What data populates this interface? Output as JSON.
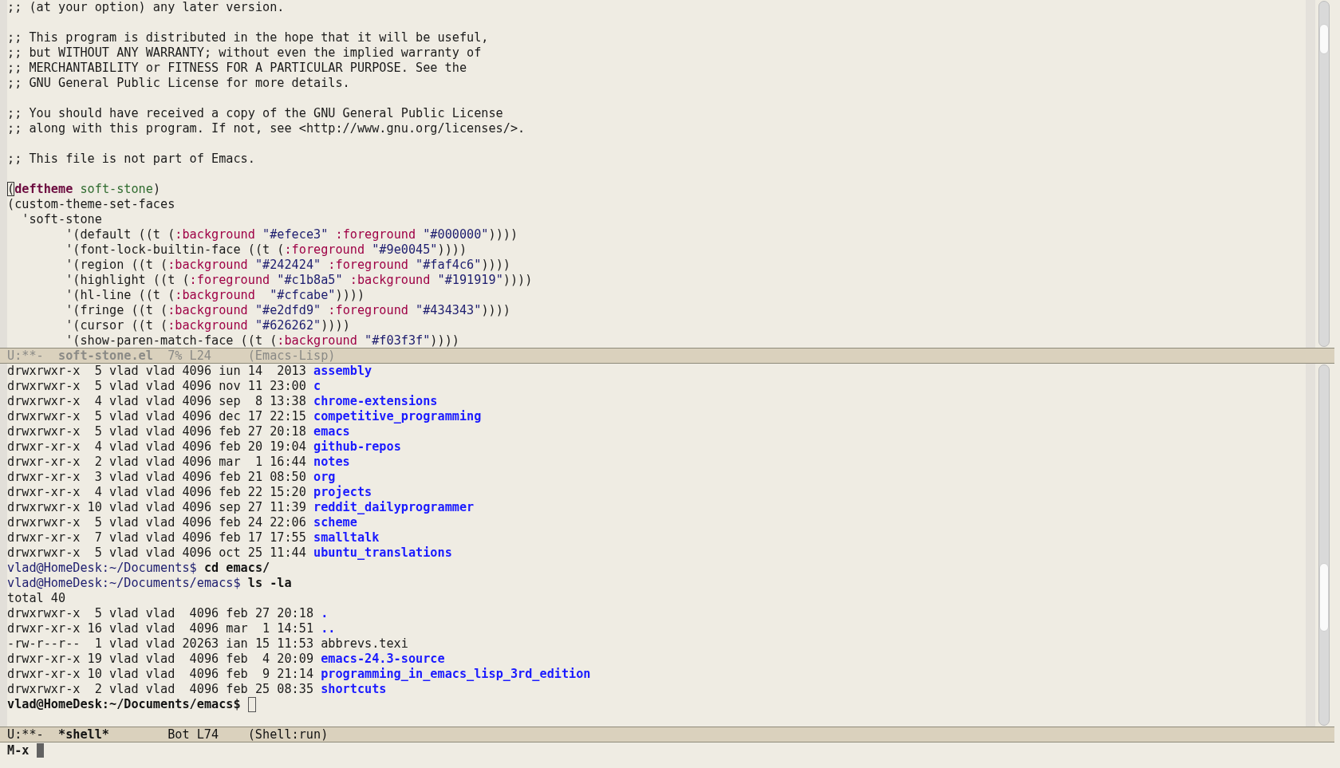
{
  "editor": {
    "lines": [
      {
        "kind": "text",
        "segments": [
          {
            "text": ";; (at your option) any later version.",
            "kind": "plain"
          }
        ]
      },
      {
        "kind": "blank"
      },
      {
        "kind": "text",
        "segments": [
          {
            "text": ";; This program is distributed in the hope that it will be useful,",
            "kind": "plain"
          }
        ]
      },
      {
        "kind": "text",
        "segments": [
          {
            "text": ";; but WITHOUT ANY WARRANTY; without even the implied warranty of",
            "kind": "plain"
          }
        ]
      },
      {
        "kind": "text",
        "segments": [
          {
            "text": ";; MERCHANTABILITY or FITNESS FOR A PARTICULAR PURPOSE. See the",
            "kind": "plain"
          }
        ]
      },
      {
        "kind": "text",
        "segments": [
          {
            "text": ";; GNU General Public License for more details.",
            "kind": "plain"
          }
        ]
      },
      {
        "kind": "blank"
      },
      {
        "kind": "text",
        "segments": [
          {
            "text": ";; You should have received a copy of the GNU General Public License",
            "kind": "plain"
          }
        ]
      },
      {
        "kind": "text",
        "segments": [
          {
            "text": ";; along with this program. If not, see <http://www.gnu.org/licenses/>.",
            "kind": "plain"
          }
        ]
      },
      {
        "kind": "blank"
      },
      {
        "kind": "text",
        "segments": [
          {
            "text": ";; This file is not part of Emacs.",
            "kind": "plain"
          }
        ]
      },
      {
        "kind": "blank"
      },
      {
        "kind": "text",
        "segments": [
          {
            "text": "(",
            "kind": "cursor"
          },
          {
            "text": "deftheme ",
            "kind": "keyword"
          },
          {
            "text": "soft-stone",
            "kind": "name"
          },
          {
            "text": ")",
            "kind": "plain"
          }
        ]
      },
      {
        "kind": "text",
        "segments": [
          {
            "text": "(custom-theme-set-faces",
            "kind": "plain"
          }
        ]
      },
      {
        "kind": "text",
        "segments": [
          {
            "text": "  'soft-stone",
            "kind": "plain"
          }
        ]
      },
      {
        "kind": "text",
        "segments": [
          {
            "text": "        '(default ((t (",
            "kind": "plain"
          },
          {
            "text": ":background ",
            "kind": "builtin"
          },
          {
            "text": "\"#efece3\" ",
            "kind": "string"
          },
          {
            "text": ":foreground ",
            "kind": "builtin"
          },
          {
            "text": "\"#000000\"",
            "kind": "string"
          },
          {
            "text": "))))",
            "kind": "plain"
          }
        ]
      },
      {
        "kind": "text",
        "segments": [
          {
            "text": "        '(font-lock-builtin-face ((t (",
            "kind": "plain"
          },
          {
            "text": ":foreground ",
            "kind": "builtin"
          },
          {
            "text": "\"#9e0045\"",
            "kind": "string"
          },
          {
            "text": "))))",
            "kind": "plain"
          }
        ]
      },
      {
        "kind": "text",
        "segments": [
          {
            "text": "        '(region ((t (",
            "kind": "plain"
          },
          {
            "text": ":background ",
            "kind": "builtin"
          },
          {
            "text": "\"#242424\" ",
            "kind": "string"
          },
          {
            "text": ":foreground ",
            "kind": "builtin"
          },
          {
            "text": "\"#faf4c6\"",
            "kind": "string"
          },
          {
            "text": "))))",
            "kind": "plain"
          }
        ]
      },
      {
        "kind": "text",
        "segments": [
          {
            "text": "        '(highlight ((t (",
            "kind": "plain"
          },
          {
            "text": ":foreground ",
            "kind": "builtin"
          },
          {
            "text": "\"#c1b8a5\" ",
            "kind": "string"
          },
          {
            "text": ":background ",
            "kind": "builtin"
          },
          {
            "text": "\"#191919\"",
            "kind": "string"
          },
          {
            "text": "))))",
            "kind": "plain"
          }
        ]
      },
      {
        "kind": "text",
        "segments": [
          {
            "text": "        '(hl-line ((t (",
            "kind": "plain"
          },
          {
            "text": ":background  ",
            "kind": "builtin"
          },
          {
            "text": "\"#cfcabe\"",
            "kind": "string"
          },
          {
            "text": "))))",
            "kind": "plain"
          }
        ]
      },
      {
        "kind": "text",
        "segments": [
          {
            "text": "        '(fringe ((t (",
            "kind": "plain"
          },
          {
            "text": ":background ",
            "kind": "builtin"
          },
          {
            "text": "\"#e2dfd9\" ",
            "kind": "string"
          },
          {
            "text": ":foreground ",
            "kind": "builtin"
          },
          {
            "text": "\"#434343\"",
            "kind": "string"
          },
          {
            "text": "))))",
            "kind": "plain"
          }
        ]
      },
      {
        "kind": "text",
        "segments": [
          {
            "text": "        '(cursor ((t (",
            "kind": "plain"
          },
          {
            "text": ":background ",
            "kind": "builtin"
          },
          {
            "text": "\"#626262\"",
            "kind": "string"
          },
          {
            "text": "))))",
            "kind": "plain"
          }
        ]
      },
      {
        "kind": "text",
        "segments": [
          {
            "text": "        '(show-paren-match-face ((t (",
            "kind": "plain"
          },
          {
            "text": ":background ",
            "kind": "builtin"
          },
          {
            "text": "\"#f03f3f\"",
            "kind": "string"
          },
          {
            "text": "))))",
            "kind": "plain"
          }
        ]
      }
    ],
    "mode_line": {
      "active": false,
      "status": "U:**-",
      "buffer": "soft-stone.el",
      "position": "7% L24",
      "mode": "(Emacs-Lisp)"
    }
  },
  "shell": {
    "lines": [
      {
        "kind": "text",
        "segments": [
          {
            "text": "drwxrwxr-x  5 vlad vlad 4096 iun 14  2013 ",
            "kind": "plain"
          },
          {
            "text": "assembly",
            "kind": "dir"
          }
        ]
      },
      {
        "kind": "text",
        "segments": [
          {
            "text": "drwxrwxr-x  5 vlad vlad 4096 nov 11 23:00 ",
            "kind": "plain"
          },
          {
            "text": "c",
            "kind": "dir"
          }
        ]
      },
      {
        "kind": "text",
        "segments": [
          {
            "text": "drwxrwxr-x  4 vlad vlad 4096 sep  8 13:38 ",
            "kind": "plain"
          },
          {
            "text": "chrome-extensions",
            "kind": "dir"
          }
        ]
      },
      {
        "kind": "text",
        "segments": [
          {
            "text": "drwxrwxr-x  5 vlad vlad 4096 dec 17 22:15 ",
            "kind": "plain"
          },
          {
            "text": "competitive_programming",
            "kind": "dir"
          }
        ]
      },
      {
        "kind": "text",
        "segments": [
          {
            "text": "drwxrwxr-x  5 vlad vlad 4096 feb 27 20:18 ",
            "kind": "plain"
          },
          {
            "text": "emacs",
            "kind": "dir"
          }
        ]
      },
      {
        "kind": "text",
        "segments": [
          {
            "text": "drwxr-xr-x  4 vlad vlad 4096 feb 20 19:04 ",
            "kind": "plain"
          },
          {
            "text": "github-repos",
            "kind": "dir"
          }
        ]
      },
      {
        "kind": "text",
        "segments": [
          {
            "text": "drwxr-xr-x  2 vlad vlad 4096 mar  1 16:44 ",
            "kind": "plain"
          },
          {
            "text": "notes",
            "kind": "dir"
          }
        ]
      },
      {
        "kind": "text",
        "segments": [
          {
            "text": "drwxr-xr-x  3 vlad vlad 4096 feb 21 08:50 ",
            "kind": "plain"
          },
          {
            "text": "org",
            "kind": "dir"
          }
        ]
      },
      {
        "kind": "text",
        "segments": [
          {
            "text": "drwxr-xr-x  4 vlad vlad 4096 feb 22 15:20 ",
            "kind": "plain"
          },
          {
            "text": "projects",
            "kind": "dir"
          }
        ]
      },
      {
        "kind": "text",
        "segments": [
          {
            "text": "drwxrwxr-x 10 vlad vlad 4096 sep 27 11:39 ",
            "kind": "plain"
          },
          {
            "text": "reddit_dailyprogrammer",
            "kind": "dir"
          }
        ]
      },
      {
        "kind": "text",
        "segments": [
          {
            "text": "drwxrwxr-x  5 vlad vlad 4096 feb 24 22:06 ",
            "kind": "plain"
          },
          {
            "text": "scheme",
            "kind": "dir"
          }
        ]
      },
      {
        "kind": "text",
        "segments": [
          {
            "text": "drwxr-xr-x  7 vlad vlad 4096 feb 17 17:55 ",
            "kind": "plain"
          },
          {
            "text": "smalltalk",
            "kind": "dir"
          }
        ]
      },
      {
        "kind": "text",
        "segments": [
          {
            "text": "drwxrwxr-x  5 vlad vlad 4096 oct 25 11:44 ",
            "kind": "plain"
          },
          {
            "text": "ubuntu_translations",
            "kind": "dir"
          }
        ]
      },
      {
        "kind": "text",
        "segments": [
          {
            "text": "vlad@HomeDesk:~/Documents$",
            "kind": "prompt"
          },
          {
            "text": " cd emacs/",
            "kind": "command"
          }
        ]
      },
      {
        "kind": "text",
        "segments": [
          {
            "text": "vlad@HomeDesk:~/Documents/emacs$",
            "kind": "prompt"
          },
          {
            "text": " ls -la",
            "kind": "command"
          }
        ]
      },
      {
        "kind": "text",
        "segments": [
          {
            "text": "total 40",
            "kind": "plain"
          }
        ]
      },
      {
        "kind": "text",
        "segments": [
          {
            "text": "drwxrwxr-x  5 vlad vlad  4096 feb 27 20:18 ",
            "kind": "plain"
          },
          {
            "text": ".",
            "kind": "dir"
          }
        ]
      },
      {
        "kind": "text",
        "segments": [
          {
            "text": "drwxr-xr-x 16 vlad vlad  4096 mar  1 14:51 ",
            "kind": "plain"
          },
          {
            "text": "..",
            "kind": "dir"
          }
        ]
      },
      {
        "kind": "text",
        "segments": [
          {
            "text": "-rw-r--r--  1 vlad vlad 20263 ian 15 11:53 abbrevs.texi",
            "kind": "plain"
          }
        ]
      },
      {
        "kind": "text",
        "segments": [
          {
            "text": "drwxr-xr-x 19 vlad vlad  4096 feb  4 20:09 ",
            "kind": "plain"
          },
          {
            "text": "emacs-24.3-source",
            "kind": "dir"
          }
        ]
      },
      {
        "kind": "text",
        "segments": [
          {
            "text": "drwxr-xr-x 10 vlad vlad  4096 feb  9 21:14 ",
            "kind": "plain"
          },
          {
            "text": "programming_in_emacs_lisp_3rd_edition",
            "kind": "dir"
          }
        ]
      },
      {
        "kind": "text",
        "segments": [
          {
            "text": "drwxrwxr-x  2 vlad vlad  4096 feb 25 08:35 ",
            "kind": "plain"
          },
          {
            "text": "shortcuts",
            "kind": "dir"
          }
        ]
      },
      {
        "kind": "prompt_line",
        "segments": [
          {
            "text": "vlad@HomeDesk:~/Documents/emacs$",
            "kind": "command"
          }
        ]
      }
    ],
    "mode_line": {
      "active": true,
      "status": "U:**-",
      "buffer": "*shell*",
      "position": "Bot L74",
      "mode": "(Shell:run)"
    }
  },
  "minibuffer": {
    "text": "M-x"
  }
}
